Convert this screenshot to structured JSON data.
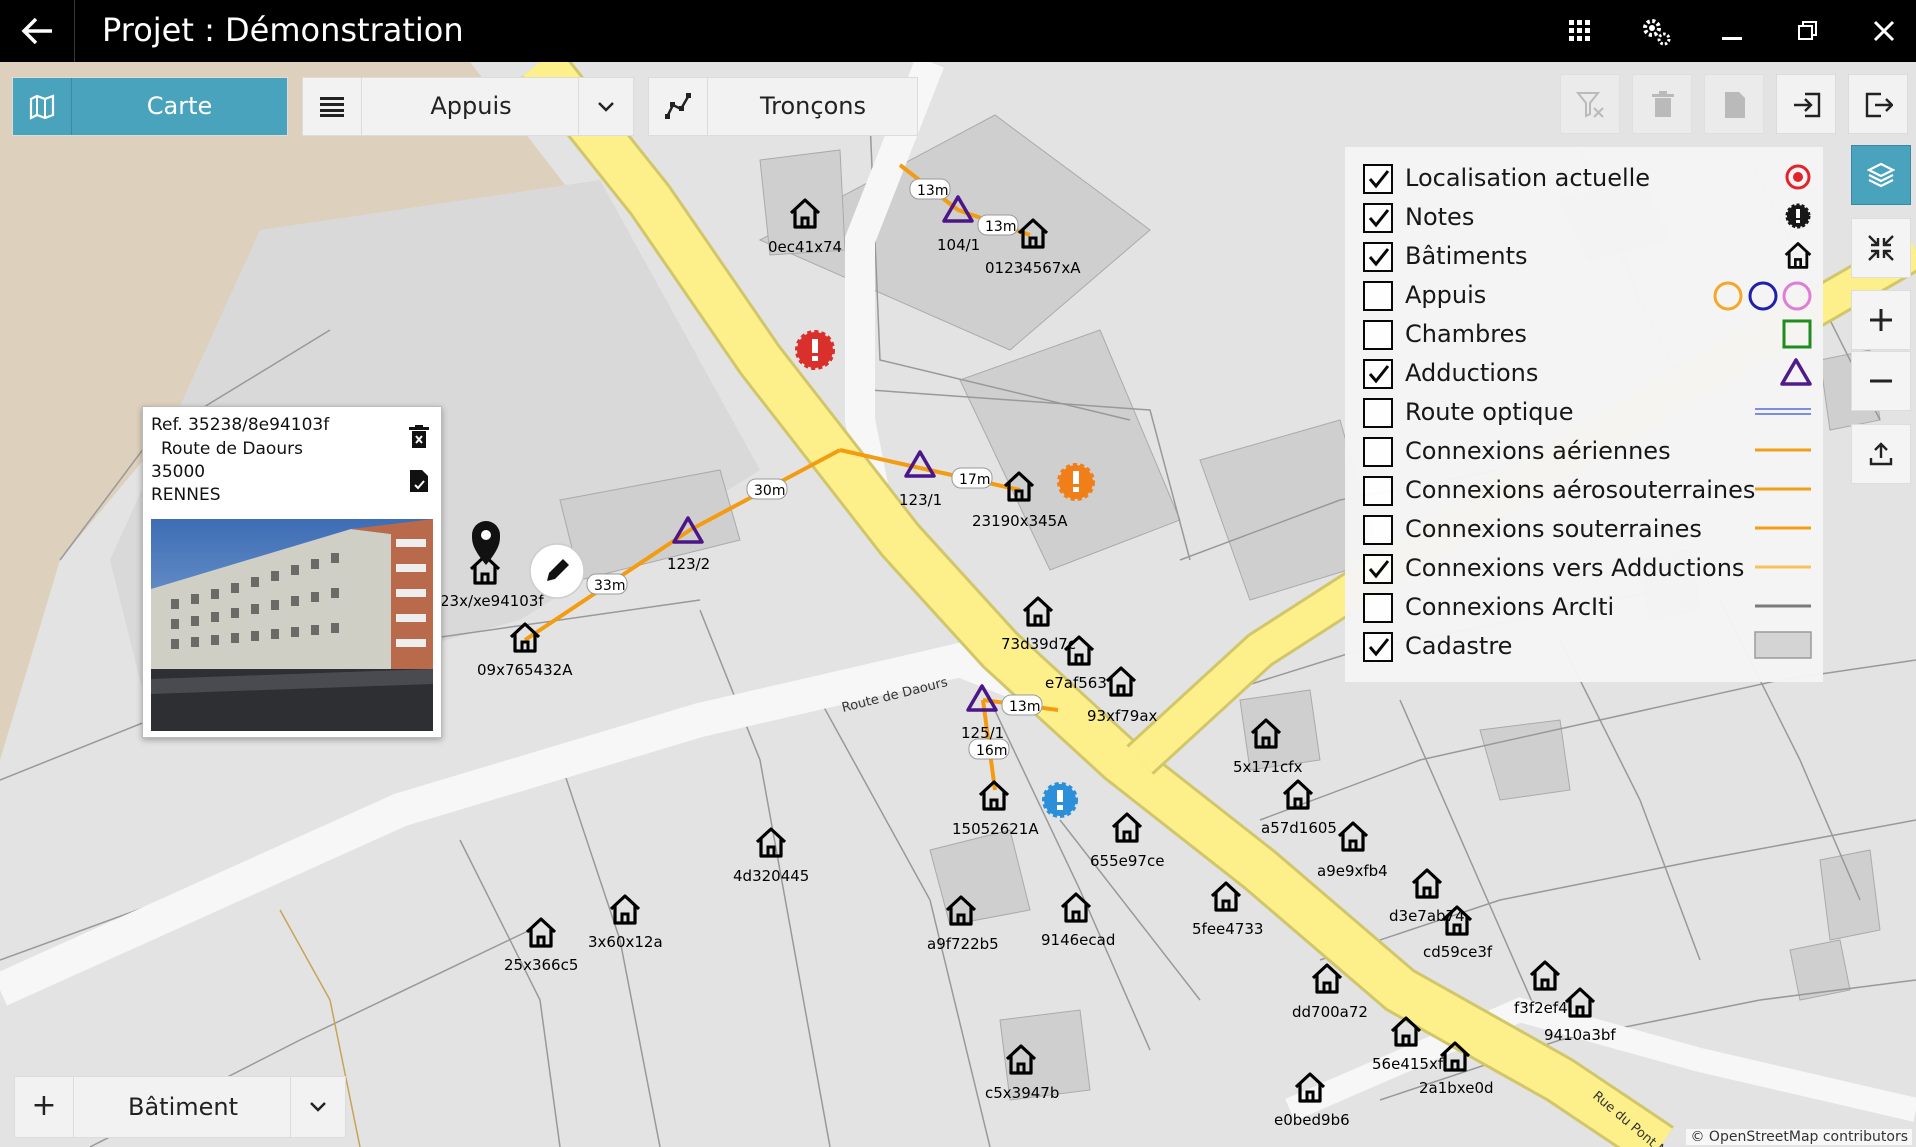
{
  "window": {
    "title": "Projet : Démonstration"
  },
  "toolbar": {
    "map_label": "Carte",
    "poles_label": "Appuis",
    "sections_label": "Tronçons"
  },
  "legend": {
    "items": [
      {
        "label": "Localisation actuelle",
        "checked": true
      },
      {
        "label": "Notes",
        "checked": true
      },
      {
        "label": "Bâtiments",
        "checked": true
      },
      {
        "label": "Appuis",
        "checked": false
      },
      {
        "label": "Chambres",
        "checked": false
      },
      {
        "label": "Adductions",
        "checked": true
      },
      {
        "label": "Route optique",
        "checked": false
      },
      {
        "label": "Connexions aériennes",
        "checked": false
      },
      {
        "label": "Connexions aérosouterraines",
        "checked": false
      },
      {
        "label": "Connexions souterraines",
        "checked": false
      },
      {
        "label": "Connexions vers Adductions",
        "checked": true
      },
      {
        "label": "Connexions ArcIti",
        "checked": false
      },
      {
        "label": "Cadastre",
        "checked": true
      }
    ]
  },
  "popup": {
    "ref": "Ref. 35238/8e94103f",
    "street": "Route de Daours",
    "postcode": "35000",
    "city": "RENNES"
  },
  "map": {
    "buildings": [
      "0ec41x74",
      "01234567xA",
      "23190x345A",
      "09x765432A",
      "23x/xe94103f",
      "73d39d7c",
      "e7af563",
      "93xf79ax",
      "15052621A",
      "655e97ce",
      "5x171cfx",
      "a57d1605",
      "a9e9xfb4",
      "d3e7ab74",
      "cd59ce3f",
      "4d320445",
      "3x60x12a",
      "25x366c5",
      "a9f722b5",
      "9146ecad",
      "5fee4733",
      "dd700a72",
      "f3f2ef4",
      "9410a3bf",
      "56e415xf",
      "2a1bxe0d",
      "c5x3947b",
      "e0bed9b6"
    ],
    "adductions": [
      "104/1",
      "123/1",
      "123/2",
      "125/1"
    ],
    "distances": [
      "13m",
      "13m",
      "17m",
      "30m",
      "33m",
      "13m",
      "16m"
    ],
    "streets": [
      "Route de Daours",
      "Rue du Pont Nov"
    ]
  },
  "bottom": {
    "add": "+",
    "type_label": "Bâtiment"
  },
  "credit": "© OpenStreetMap contributors",
  "colors": {
    "accent": "#4aa3bd",
    "road": "#fdf08a",
    "connection": "#f39c12",
    "adduction": "#4b1687",
    "alert_red": "#d9302b",
    "alert_orange": "#f07e19",
    "alert_blue": "#2b8fd9"
  }
}
